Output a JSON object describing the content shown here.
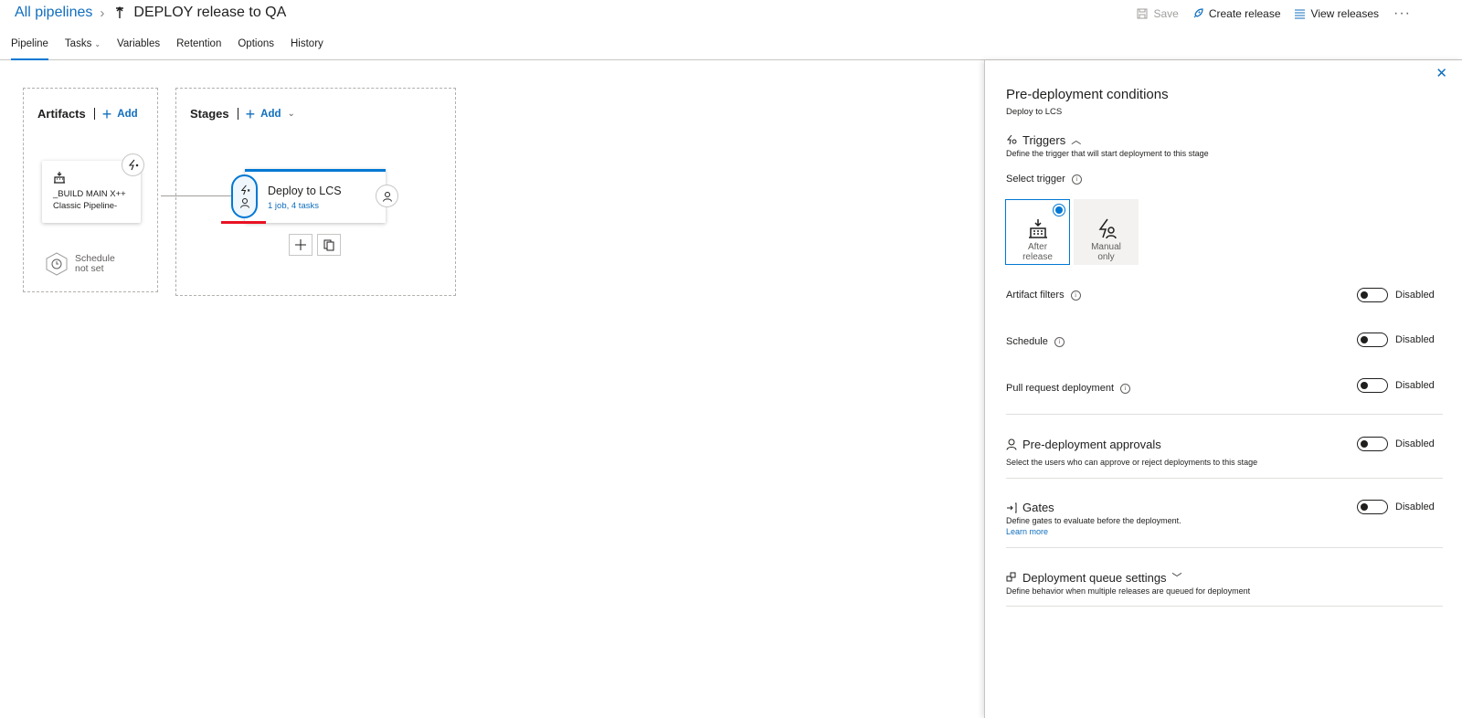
{
  "header": {
    "breadcrumb_root": "All pipelines",
    "pipeline_title": "DEPLOY release to QA",
    "commands": {
      "save": "Save",
      "create_release": "Create release",
      "view_releases": "View releases",
      "more": "···"
    }
  },
  "tabs": [
    {
      "label": "Pipeline",
      "active": true
    },
    {
      "label": "Tasks",
      "has_dropdown": true
    },
    {
      "label": "Variables"
    },
    {
      "label": "Retention"
    },
    {
      "label": "Options"
    },
    {
      "label": "History"
    }
  ],
  "canvas": {
    "artifacts": {
      "title": "Artifacts",
      "add_label": "Add",
      "card": {
        "name": "_BUILD MAIN X++",
        "subtitle": "Classic Pipeline-"
      },
      "schedule_line1": "Schedule",
      "schedule_line2": "not set"
    },
    "stages": {
      "title": "Stages",
      "add_label": "Add",
      "stage": {
        "name": "Deploy to LCS",
        "summary": "1 job, 4 tasks"
      }
    }
  },
  "panel": {
    "title": "Pre-deployment conditions",
    "subtitle": "Deploy to LCS",
    "close_icon": "✕",
    "triggers": {
      "title": "Triggers",
      "description": "Define the trigger that will start deployment to this stage",
      "select_label": "Select trigger",
      "options": [
        {
          "line1": "After",
          "line2": "release",
          "selected": true
        },
        {
          "line1": "Manual",
          "line2": "only",
          "selected": false
        }
      ]
    },
    "toggles": [
      {
        "label": "Artifact filters",
        "state": "Disabled"
      },
      {
        "label": "Schedule",
        "state": "Disabled"
      },
      {
        "label": "Pull request deployment",
        "state": "Disabled"
      }
    ],
    "approvals": {
      "title": "Pre-deployment approvals",
      "description": "Select the users who can approve or reject deployments to this stage",
      "state": "Disabled"
    },
    "gates": {
      "title": "Gates",
      "description": "Define gates to evaluate before the deployment.",
      "link": "Learn more",
      "state": "Disabled"
    },
    "queue": {
      "title": "Deployment queue settings",
      "description": "Define behavior when multiple releases are queued for deployment"
    }
  },
  "colors": {
    "accent": "#0078d4",
    "link": "#106ebe",
    "highlight": "#e81123"
  }
}
